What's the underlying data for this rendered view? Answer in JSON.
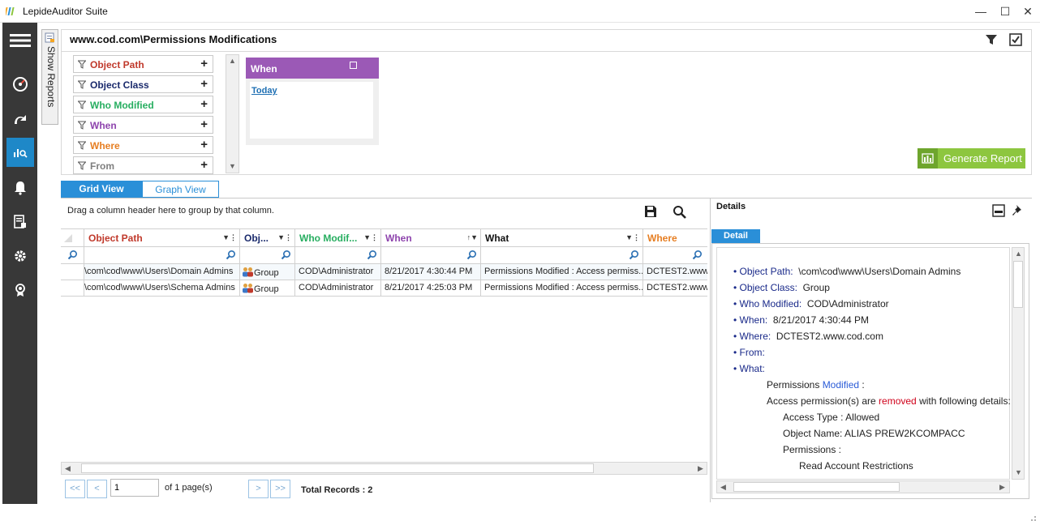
{
  "window": {
    "title": "LepideAuditor Suite",
    "minimize": "—",
    "maximize": "☐",
    "close": "✕"
  },
  "sidebar": {
    "show_reports_label": "Show Reports",
    "nav_items": [
      "menu-icon",
      "dashboard-icon",
      "radar-icon",
      "audit-reports-icon",
      "alerts-icon",
      "reports-icon",
      "settings-icon",
      "license-icon"
    ],
    "active_item": "audit-reports-icon",
    "accent": "#1e88c8"
  },
  "header": {
    "title": "www.cod.com\\Permissions Modifications"
  },
  "filters": [
    {
      "label": "Object Path",
      "color": "#c0392b"
    },
    {
      "label": "Object Class",
      "color": "#1a2a6c"
    },
    {
      "label": "Who Modified",
      "color": "#27ae60"
    },
    {
      "label": "When",
      "color": "#8e44ad"
    },
    {
      "label": "Where",
      "color": "#e67e22"
    },
    {
      "label": "From",
      "color": "#7f7f7f"
    }
  ],
  "when_card": {
    "title": "When",
    "value": "Today",
    "color": "#9b59b6"
  },
  "generate_report": {
    "label": "Generate Report",
    "color": "#8dc63f"
  },
  "tabs": {
    "grid_view": "Grid View",
    "graph_view": "Graph View",
    "active": "Grid View"
  },
  "grid": {
    "group_hint": "Drag a column header here to group by that column.",
    "columns": [
      {
        "label": "Object Path",
        "color": "#c0392b"
      },
      {
        "label": "Obj...",
        "color": "#1a2a6c"
      },
      {
        "label": "Who Modif...",
        "color": "#27ae60"
      },
      {
        "label": "When",
        "color": "#8e44ad"
      },
      {
        "label": "What",
        "color": "#111111"
      },
      {
        "label": "Where",
        "color": "#e67e22"
      }
    ],
    "rows": [
      [
        "\\com\\cod\\www\\Users\\Domain Admins",
        "Group",
        "COD\\Administrator",
        "8/21/2017 4:30:44 PM",
        "Permissions Modified :  Access permiss...",
        "DCTEST2.www"
      ],
      [
        "\\com\\cod\\www\\Users\\Schema Admins",
        "Group",
        "COD\\Administrator",
        "8/21/2017 4:25:03 PM",
        "Permissions Modified :  Access permiss...",
        "DCTEST2.www"
      ]
    ]
  },
  "pager": {
    "first": "<<",
    "prev": "<",
    "next": ">",
    "last": ">>",
    "page_value": "1",
    "of_pages": "of 1 page(s)",
    "total_records": "Total Records : 2"
  },
  "details": {
    "title": "Details",
    "tab": "Detail",
    "fields": [
      {
        "key": "Object Path:",
        "value": "\\com\\cod\\www\\Users\\Domain Admins"
      },
      {
        "key": "Object Class:",
        "value": "Group"
      },
      {
        "key": "Who Modified:",
        "value": "COD\\Administrator"
      },
      {
        "key": "When:",
        "value": "8/21/2017 4:30:44 PM"
      },
      {
        "key": "Where:",
        "value": "DCTEST2.www.cod.com"
      },
      {
        "key": "From:",
        "value": ""
      },
      {
        "key": "What:",
        "value": ""
      }
    ],
    "what": {
      "line1_a": "Permissions ",
      "line1_b": "Modified",
      "line1_c": " :",
      "line2_a": "Access permission(s) are ",
      "line2_b": "removed",
      "line2_c": " with following details:",
      "access_type": "Access Type : Allowed",
      "object_name": "Object Name: ALIAS PREW2KCOMPACC",
      "permissions": "Permissions :",
      "permission_item": "Read  Account Restrictions"
    }
  }
}
